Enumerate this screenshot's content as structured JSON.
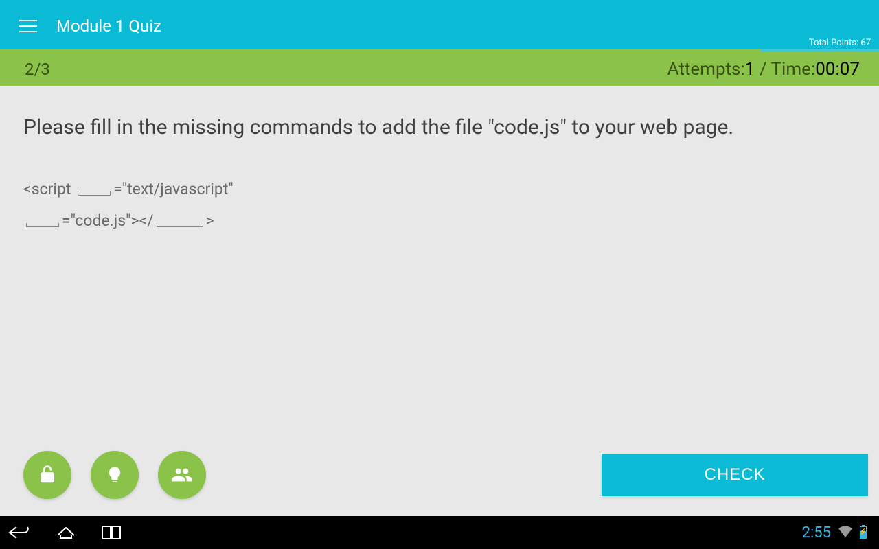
{
  "header": {
    "title": "Module 1 Quiz",
    "points_label": "Total Points: 67"
  },
  "infobar": {
    "counter": "2/3",
    "attempts_label": "Attempts:",
    "attempts_value": "1",
    "separator": " / ",
    "time_label": "Time:",
    "time_value": "00:07"
  },
  "question": {
    "prompt": "Please fill in the missing commands to add the file \"code.js\" to your web page.",
    "code_line1_a": "<script ",
    "code_line1_b": "=\"text/javascript\"",
    "code_line2_a": "=\"code.js\"></",
    "code_line2_b": ">"
  },
  "footer": {
    "check_label": "CHECK"
  },
  "navbar": {
    "clock": "2:55"
  }
}
